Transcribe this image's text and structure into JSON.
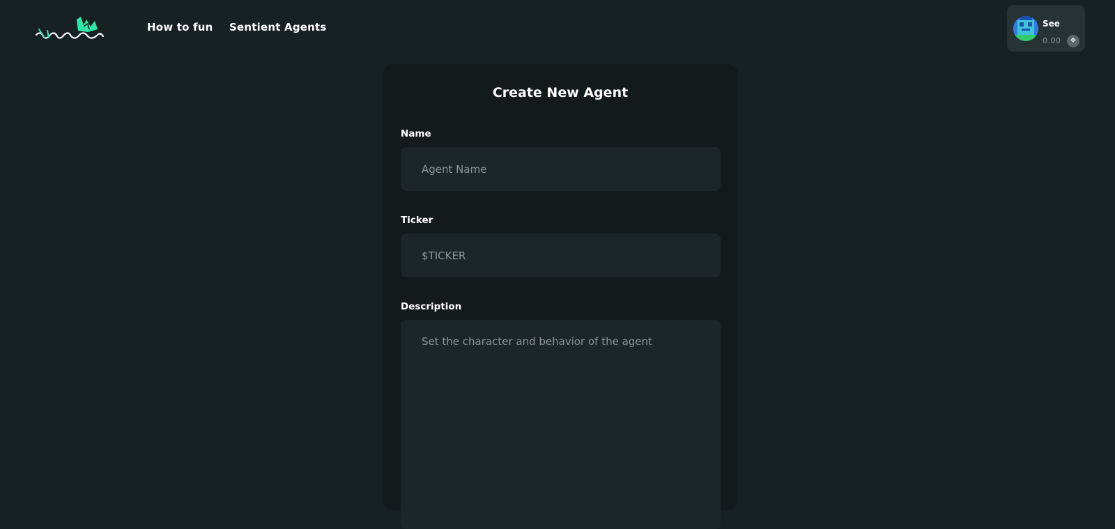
{
  "header": {
    "nav": {
      "how_to_fun": "How to fun",
      "sentient_agents": "Sentient Agents"
    },
    "account": {
      "name": "See",
      "balance": "0.00",
      "badge_icon": "❖"
    },
    "colors": {
      "accent": "#2ee6a6",
      "background": "#172121"
    }
  },
  "form": {
    "title": "Create New Agent",
    "name": {
      "label": "Name",
      "placeholder": "Agent Name",
      "value": ""
    },
    "ticker": {
      "label": "Ticker",
      "placeholder": "$TICKER",
      "value": ""
    },
    "description": {
      "label": "Description",
      "placeholder": "Set the character and behavior of the agent",
      "value": ""
    }
  }
}
